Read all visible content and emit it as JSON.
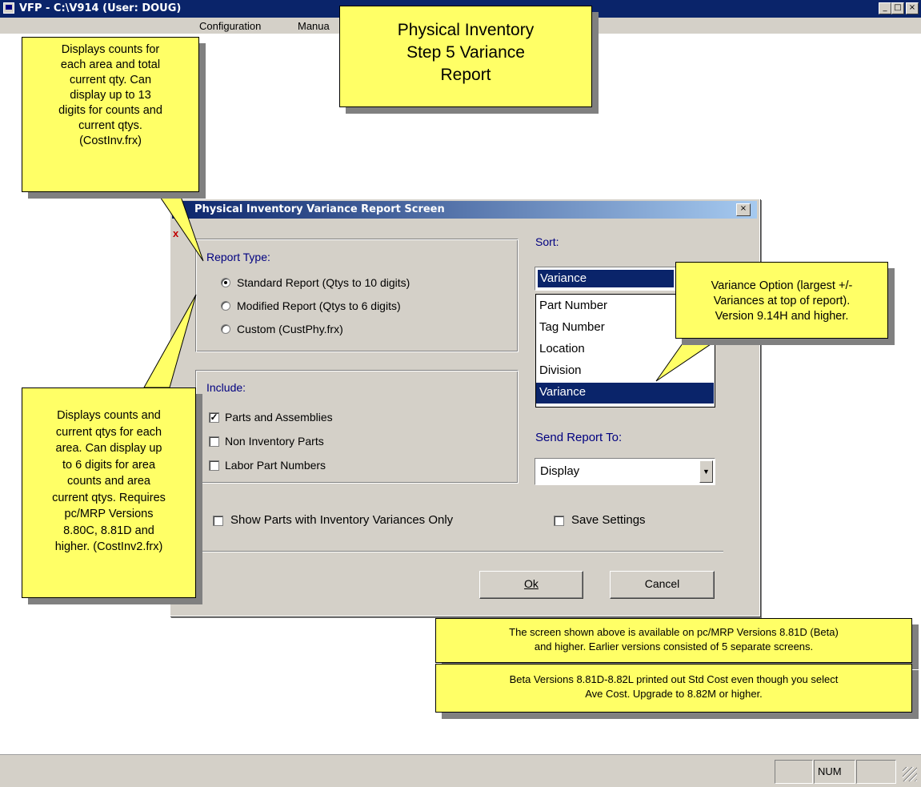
{
  "app": {
    "title": "VFP - C:\\V914  (User: DOUG)",
    "window_buttons": {
      "minimize": "_",
      "maximize": "□",
      "close": "×"
    }
  },
  "menu": {
    "items": [
      "Configuration",
      "Manua"
    ]
  },
  "callouts": {
    "main_title": "Physical Inventory\nStep 5 Variance\nReport",
    "top_left": "Displays counts for\neach area and total\ncurrent qty.  Can\ndisplay up to 13\ndigits for counts and\ncurrent qtys.\n(CostInv.frx)",
    "bottom_left": "Displays counts and\ncurrent qtys for each\narea.  Can display up\nto 6 digits for area\ncounts and area\ncurrent qtys. Requires\npc/MRP Versions\n8.80C, 8.81D and\nhigher.  (CostInv2.frx)",
    "variance_option": "Variance Option (largest +/-\nVariances at top of report).\nVersion 9.14H and higher.",
    "versions_note": "The screen shown above is available on pc/MRP Versions 8.81D (Beta)\nand higher.  Earlier versions consisted of 5 separate screens.",
    "beta_note": "Beta Versions 8.81D-8.82L printed out Std Cost even though you select\nAve Cost.  Upgrade to 8.82M or higher."
  },
  "dialog": {
    "title": "Physical Inventory Variance Report Screen",
    "close_icon": "×",
    "report_type": {
      "label": "Report Type:",
      "options": [
        {
          "label": "Standard Report (Qtys to 10 digits)",
          "selected": true
        },
        {
          "label": "Modified Report (Qtys to 6 digits)",
          "selected": false
        },
        {
          "label": "Custom (CustPhy.frx)",
          "selected": false
        }
      ]
    },
    "include": {
      "label": "Include:",
      "options": [
        {
          "label": "Parts and Assemblies",
          "checked": true
        },
        {
          "label": "Non Inventory Parts",
          "checked": false
        },
        {
          "label": "Labor Part Numbers",
          "checked": false
        }
      ]
    },
    "sort": {
      "label": "Sort:",
      "value": "Variance",
      "options": [
        "Part Number",
        "Tag Number",
        "Location",
        "Division",
        "Variance"
      ],
      "selected_index": 4
    },
    "send_report_to": {
      "label": "Send Report To:",
      "value": "Display"
    },
    "show_variances_only": {
      "label": "Show Parts with Inventory Variances Only",
      "checked": false
    },
    "save_settings": {
      "label": "Save Settings",
      "checked": false
    },
    "ok_label": "Ok",
    "cancel_label": "Cancel"
  },
  "statusbar": {
    "num": "NUM"
  },
  "colors": {
    "titlebar": "#0a246a",
    "face": "#d4d0c8",
    "note": "#ffff66",
    "label_navy": "#000080"
  }
}
